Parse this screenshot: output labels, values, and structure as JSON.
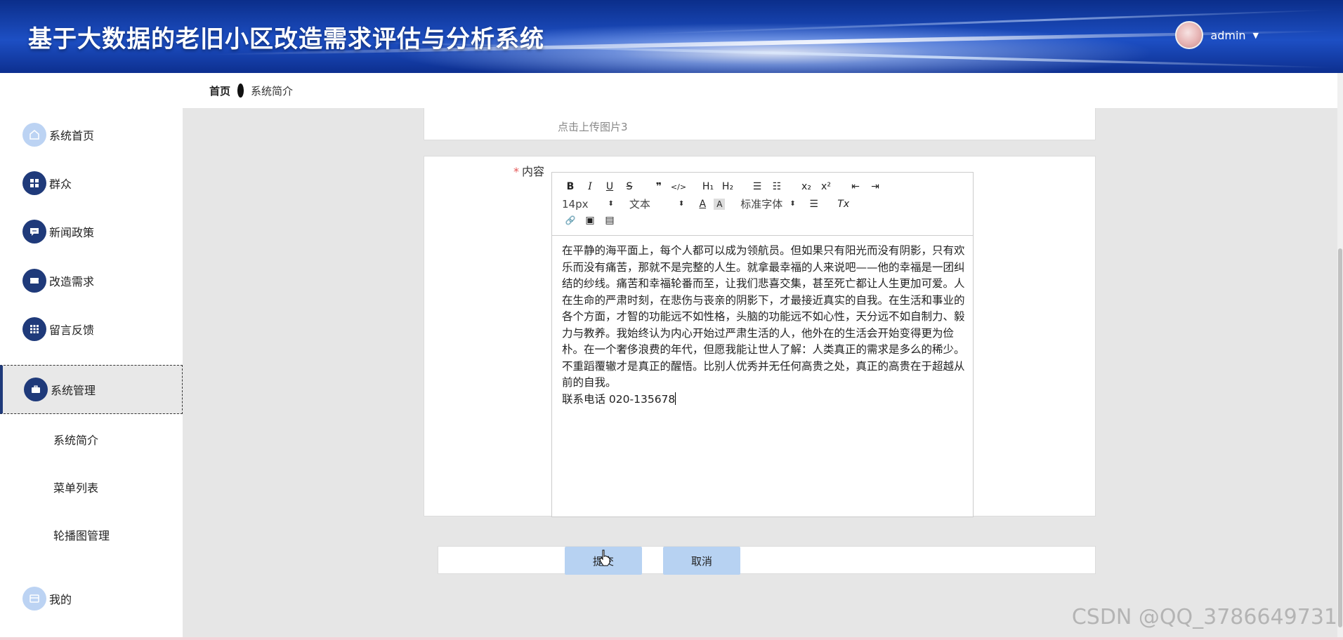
{
  "app": {
    "title": "基于大数据的老旧小区改造需求评估与分析系统"
  },
  "user": {
    "name": "admin",
    "caret": "▼"
  },
  "breadcrumb": {
    "home": "首页",
    "current": "系统简介"
  },
  "sidebar": {
    "items": [
      {
        "label": "系统首页",
        "icon": "home-icon"
      },
      {
        "label": "群众",
        "icon": "grid-icon"
      },
      {
        "label": "新闻政策",
        "icon": "chat-icon"
      },
      {
        "label": "改造需求",
        "icon": "ticket-icon"
      },
      {
        "label": "留言反馈",
        "icon": "apps-icon"
      },
      {
        "label": "系统管理",
        "icon": "briefcase-icon",
        "active": true
      },
      {
        "label": "我的",
        "icon": "wallet-icon"
      }
    ],
    "sub_items": [
      {
        "label": "系统简介"
      },
      {
        "label": "菜单列表"
      },
      {
        "label": "轮播图管理"
      }
    ]
  },
  "upload": {
    "hint": "点击上传图片3"
  },
  "form": {
    "content_label": "内容",
    "required_mark": "*"
  },
  "toolbar": {
    "row1": [
      "B",
      "I",
      "U",
      "S",
      "❞",
      "</>",
      "H₁",
      "H₂",
      "☰",
      "☷",
      "x₂",
      "x²",
      "⇤",
      "⇥"
    ],
    "font_size": "14px",
    "text_type": "文本",
    "font_family": "标准字体",
    "color_btn": "A",
    "bg_btn": "A",
    "align_btn": "☰",
    "clear_btn": "Tx",
    "row3": [
      "🔗",
      "▣",
      "▤"
    ]
  },
  "editor": {
    "paragraph": "在平静的海平面上，每个人都可以成为领航员。但如果只有阳光而没有阴影，只有欢乐而没有痛苦，那就不是完整的人生。就拿最幸福的人来说吧——他的幸福是一团纠结的纱线。痛苦和幸福轮番而至，让我们悲喜交集，甚至死亡都让人生更加可爱。人在生命的严肃时刻，在悲伤与丧亲的阴影下，才最接近真实的自我。在生活和事业的各个方面，才智的功能远不如性格，头脑的功能远不如心性，天分远不如自制力、毅力与教养。我始终认为内心开始过严肃生活的人，他外在的生活会开始变得更为俭朴。在一个奢侈浪费的年代，但愿我能让世人了解：人类真正的需求是多么的稀少。不重蹈覆辙才是真正的醒悟。比别人优秀并无任何高贵之处，真正的高贵在于超越从前的自我。",
    "phone_line": "联系电话  020-135678"
  },
  "actions": {
    "submit": "提交",
    "cancel": "取消"
  },
  "watermark": "CSDN @QQ_3786649731",
  "colors": {
    "header_blue": "#1d4fc4",
    "sidebar_icon": "#1f3a7a",
    "button_bg": "#b7d2f2",
    "required": "#e45656"
  }
}
